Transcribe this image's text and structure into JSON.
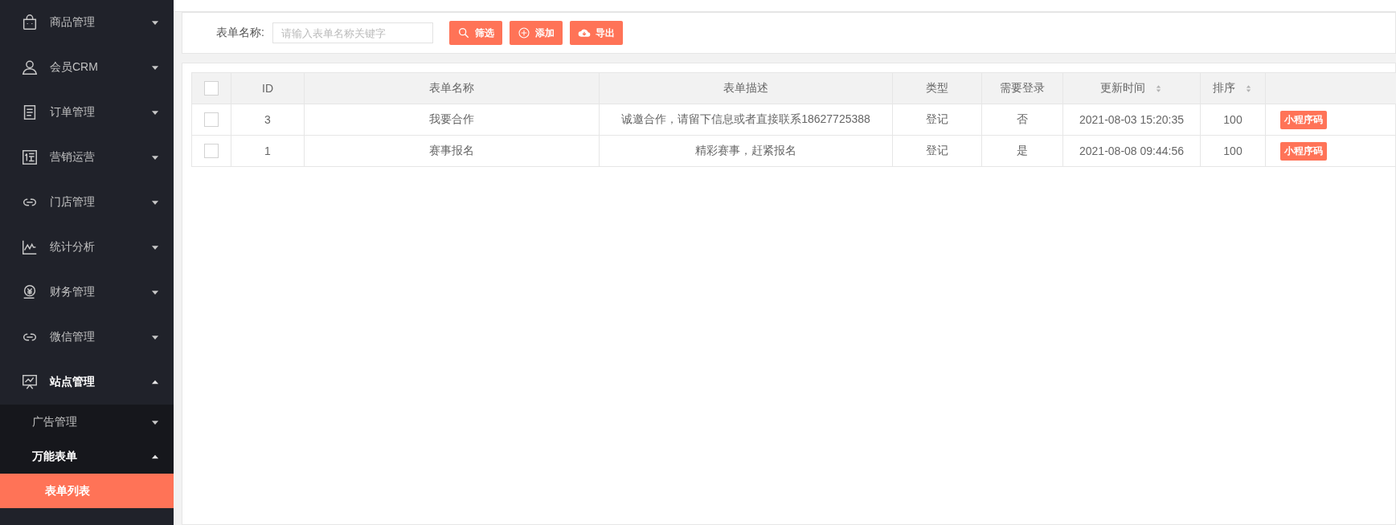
{
  "sidebar": {
    "items": [
      {
        "label": "商品管理",
        "expanded": false
      },
      {
        "label": "会员CRM",
        "expanded": false
      },
      {
        "label": "订单管理",
        "expanded": false
      },
      {
        "label": "营销运营",
        "expanded": false
      },
      {
        "label": "门店管理",
        "expanded": false
      },
      {
        "label": "统计分析",
        "expanded": false
      },
      {
        "label": "财务管理",
        "expanded": false
      },
      {
        "label": "微信管理",
        "expanded": false
      },
      {
        "label": "站点管理",
        "expanded": true,
        "children": [
          {
            "label": "广告管理",
            "expanded": false
          },
          {
            "label": "万能表单",
            "expanded": true,
            "children": [
              {
                "label": "表单列表",
                "selected": true
              }
            ]
          }
        ]
      }
    ]
  },
  "filter": {
    "label": "表单名称:",
    "placeholder": "请输入表单名称关键字",
    "buttons": [
      {
        "kind": "search",
        "label": "筛选"
      },
      {
        "kind": "add",
        "label": "添加"
      },
      {
        "kind": "export",
        "label": "导出"
      }
    ]
  },
  "table": {
    "select_all": {
      "checked": false
    },
    "columns": [
      {
        "label": "ID"
      },
      {
        "label": "表单名称"
      },
      {
        "label": "表单描述"
      },
      {
        "label": "类型"
      },
      {
        "label": "需要登录"
      },
      {
        "label": "更新时间",
        "sortable": true
      },
      {
        "label": "排序",
        "sortable": true
      }
    ],
    "rows": [
      {
        "checked": false,
        "cells": [
          "3",
          "我要合作",
          "诚邀合作，请留下信息或者直接联系18627725388",
          "登记",
          "否",
          "2021-08-03 15:20:35",
          "100"
        ],
        "action": "小程序码"
      },
      {
        "checked": false,
        "cells": [
          "1",
          "赛事报名",
          "精彩赛事，赶紧报名",
          "登记",
          "是",
          "2021-08-08 09:44:56",
          "100"
        ],
        "action": "小程序码"
      }
    ]
  }
}
